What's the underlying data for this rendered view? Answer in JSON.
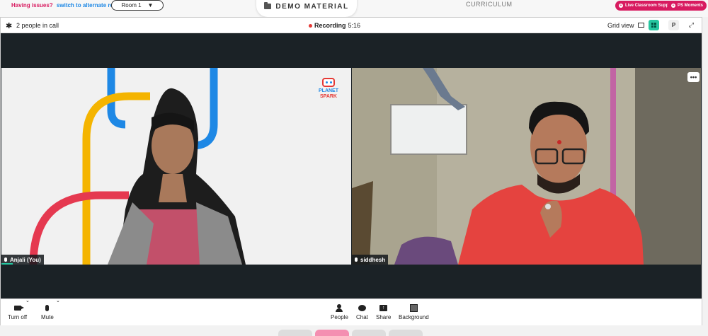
{
  "topbar": {
    "issues_question": "Having issues?",
    "issues_link": "switch to alternate room",
    "room_select": "Room 1",
    "demo_material": "DEMO MATERIAL",
    "curriculum": "CURRICULUM",
    "live_support": "Live Classroom Support",
    "ps_moments": "PS Moments"
  },
  "call_header": {
    "people_count": "2 people in call",
    "recording_label": "Recording",
    "recording_time": "5:16",
    "grid_view": "Grid view",
    "presenter_btn": "P"
  },
  "participants": [
    {
      "name": "Anjali (You)"
    },
    {
      "name": "siddhesh"
    }
  ],
  "logo": {
    "line1": "PLANET",
    "line2": "SPARK"
  },
  "toolbar": {
    "turn_off": "Turn off",
    "mute": "Mute",
    "people": "People",
    "chat": "Chat",
    "share": "Share",
    "background": "Background"
  },
  "colors": {
    "accent_teal": "#26c6a0",
    "brand_pink": "#d81b60",
    "link_blue": "#1e88e5",
    "call_bg": "#1b2226"
  }
}
